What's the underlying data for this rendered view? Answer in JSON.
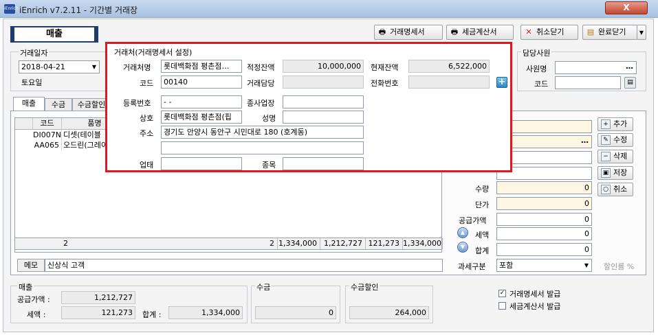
{
  "window": {
    "app_icon_text": "iEnrich",
    "title": "iEnrich v7.2.11 - 기간별 거래장",
    "close_label": "X"
  },
  "toolbar": {
    "mode_label": "매출",
    "statement_btn": "거래명세서",
    "tax_invoice_btn": "세금계산서",
    "cancel_close_btn": "취소닫기",
    "done_close_btn": "완료닫기"
  },
  "transaction_date": {
    "group_label": "거래일자",
    "date_value": "2018-04-21",
    "weekday": "토요일"
  },
  "partner": {
    "group_label": "거래처(거래명세서 설정)",
    "name_label": "거래처명",
    "name_value": "롯데백화점 평촌점…",
    "proper_balance_label": "적정잔액",
    "proper_balance_value": "10,000,000",
    "current_balance_label": "현재잔액",
    "current_balance_value": "6,522,000",
    "code_label": "코드",
    "code_value": "00140",
    "contact_label": "거래담당",
    "contact_value": "",
    "phone_label": "전화번호",
    "phone_value": "",
    "reg_no_label": "등록번호",
    "reg_no_value": "  -   -",
    "sub_business_label": "종사업장",
    "sub_business_value": "",
    "trade_name_label": "상호",
    "trade_name_value": "롯데백화점 평촌점(핍",
    "rep_name_label": "성명",
    "rep_name_value": "",
    "address_label": "주소",
    "address_line1": "경기도 안양시 동안구 시민대로 180 (호계동)",
    "address_line2": "",
    "business_type_label": "업태",
    "business_type_value": "",
    "business_item_label": "종목",
    "business_item_value": ""
  },
  "staff": {
    "group_label": "담당사원",
    "name_label": "사원명",
    "name_value": "",
    "code_label": "코드",
    "code_value": ""
  },
  "tabs": [
    "매출",
    "수금",
    "수금할인"
  ],
  "grid": {
    "headers": [
      "코드",
      "품명"
    ],
    "rows": [
      {
        "code": "DI007N",
        "name": "디셋(테이블"
      },
      {
        "code": "AA065",
        "name": "오드린(그레이"
      }
    ],
    "footer": {
      "count": "2",
      "qty_total": "2",
      "total": "1,334,000",
      "supply": "1,212,727",
      "vat": "121,273",
      "amount": "1,334,000"
    }
  },
  "item_panel": {
    "add_btn": "추가",
    "edit_btn": "수정",
    "delete_btn": "삭제",
    "save_btn": "저장",
    "cancel_btn": "취소",
    "qty_label": "수량",
    "qty_value": "0",
    "unit_price_label": "단가",
    "unit_price_value": "0",
    "supply_label": "공급가액",
    "supply_value": "0",
    "vat_label": "세액",
    "vat_value": "0",
    "total_label": "합계",
    "total_value": "0",
    "tax_type_label": "과세구분",
    "tax_type_value": "포함",
    "discount_label": "할인률 %"
  },
  "memo": {
    "label": "메모",
    "value": "신상식 고객"
  },
  "summary": {
    "sales_group": "매출",
    "supply_label": "공급가액 :",
    "supply_value": "1,212,727",
    "vat_label": "세액 :",
    "vat_value": "121,273",
    "total_label": "합계 :",
    "total_value": "1,334,000",
    "collection_group": "수금",
    "collection_value": "0",
    "collection_discount_group": "수금할인",
    "collection_discount_value": "264,000",
    "issue_statement_label": "거래명세서 발급",
    "issue_statement_checked": true,
    "issue_tax_invoice_label": "세금계산서 발급",
    "issue_tax_invoice_checked": false
  },
  "colors": {
    "highlight": "#e3161f",
    "title_bar": "#b9cde8",
    "close_button": "#c6452f",
    "yellow_field": "#fdf6e3"
  }
}
